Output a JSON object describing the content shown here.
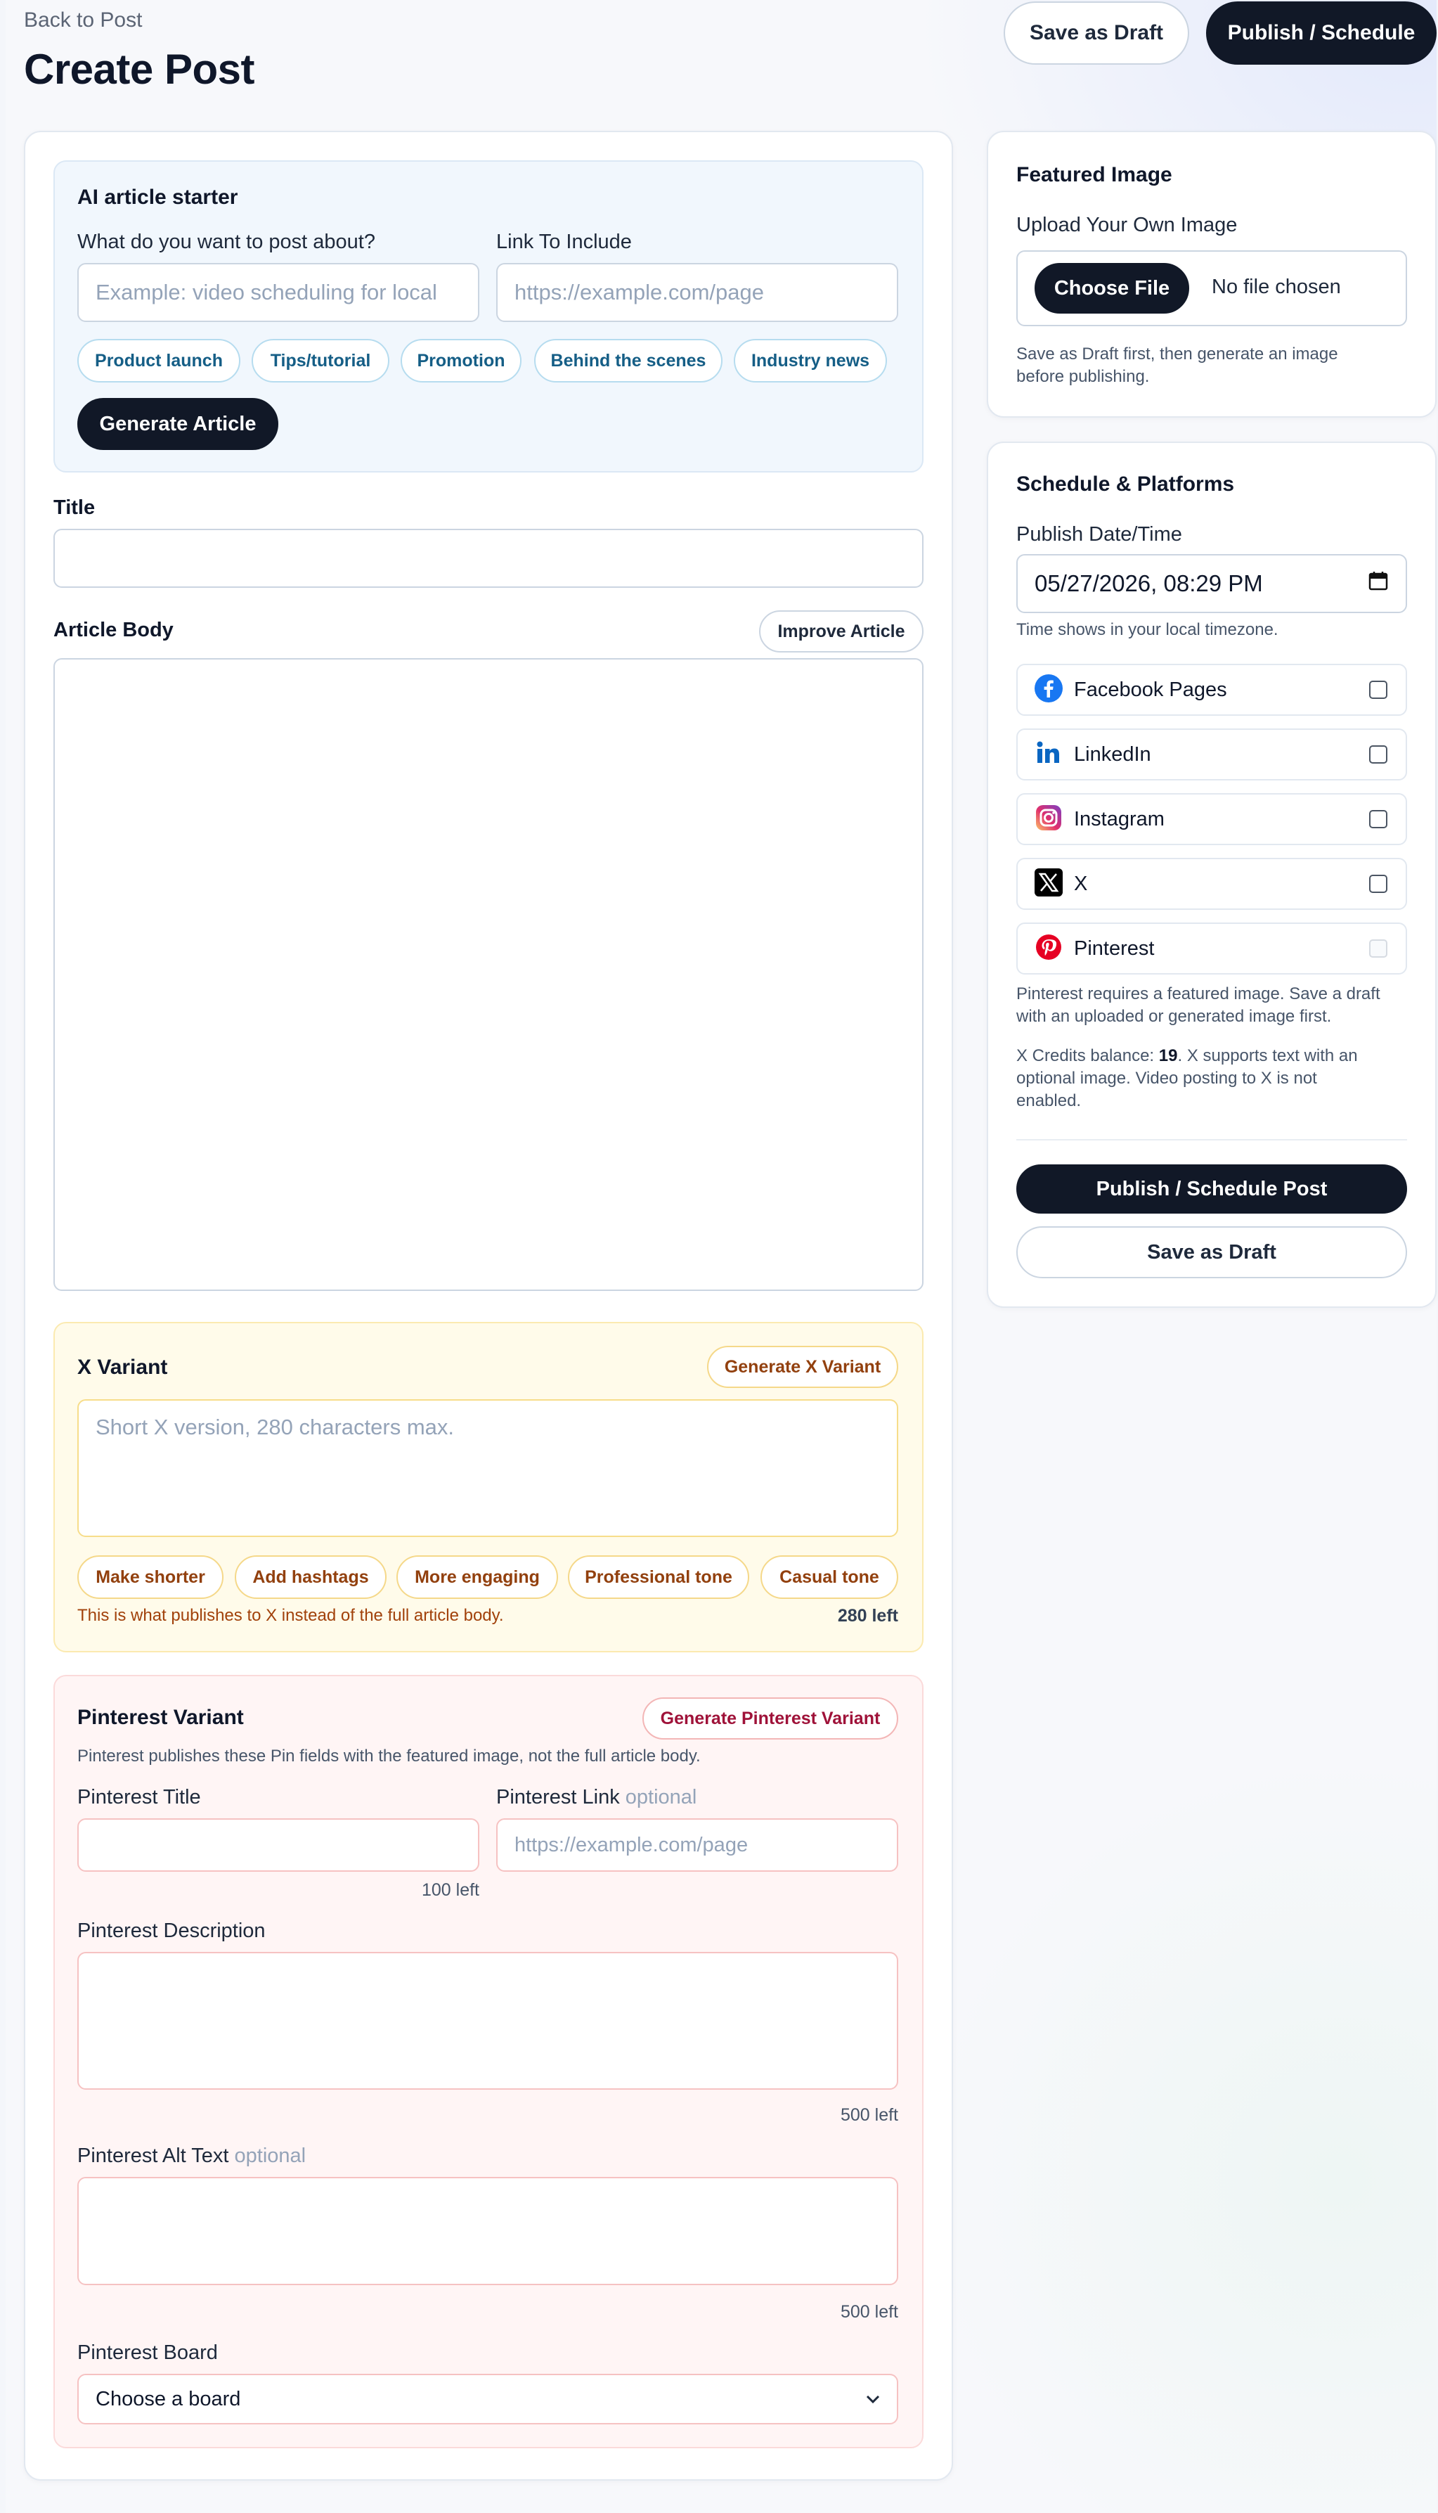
{
  "header": {
    "back_link": "Back to Post",
    "title": "Create Post",
    "save_draft": "Save as Draft",
    "publish": "Publish / Schedule"
  },
  "ai_starter": {
    "title": "AI article starter",
    "topic_label": "What do you want to post about?",
    "topic_placeholder": "Example: video scheduling for local",
    "link_label": "Link To Include",
    "link_placeholder": "https://example.com/page",
    "chips": [
      "Product launch",
      "Tips/tutorial",
      "Promotion",
      "Behind the scenes",
      "Industry news"
    ],
    "generate_button": "Generate Article"
  },
  "title_field": {
    "label": "Title",
    "value": ""
  },
  "article": {
    "label": "Article Body",
    "improve_button": "Improve Article",
    "value": ""
  },
  "x_variant": {
    "title": "X Variant",
    "generate_button": "Generate X Variant",
    "placeholder": "Short X version, 280 characters max.",
    "chips": [
      "Make shorter",
      "Add hashtags",
      "More engaging",
      "Professional tone",
      "Casual tone"
    ],
    "hint": "This is what publishes to X instead of the full article body.",
    "counter": "280 left"
  },
  "pinterest_variant": {
    "title": "Pinterest Variant",
    "generate_button": "Generate Pinterest Variant",
    "description": "Pinterest publishes these Pin fields with the featured image, not the full article body.",
    "pin_title_label": "Pinterest Title",
    "pin_title_counter": "100 left",
    "pin_link_label": "Pinterest Link",
    "optional": "optional",
    "pin_link_placeholder": "https://example.com/page",
    "pin_desc_label": "Pinterest Description",
    "pin_desc_counter": "500 left",
    "alt_label": "Pinterest Alt Text",
    "alt_counter": "500 left",
    "board_label": "Pinterest Board",
    "board_selected": "Choose a board"
  },
  "featured_image": {
    "title": "Featured Image",
    "upload_label": "Upload Your Own Image",
    "choose_button": "Choose File",
    "file_status": "No file chosen",
    "note_line1": "Save as Draft first, then generate an image",
    "note_line2": "before publishing."
  },
  "schedule": {
    "title": "Schedule & Platforms",
    "date_label": "Publish Date/Time",
    "date_value": "05/27/2026, 08:29 PM",
    "timezone_note": "Time shows in your local timezone.",
    "platforms": [
      {
        "name": "Facebook Pages",
        "icon": "facebook-icon",
        "checked": false,
        "disabled": false
      },
      {
        "name": "LinkedIn",
        "icon": "linkedin-icon",
        "checked": false,
        "disabled": false
      },
      {
        "name": "Instagram",
        "icon": "instagram-icon",
        "checked": false,
        "disabled": false
      },
      {
        "name": "X",
        "icon": "x-icon",
        "checked": false,
        "disabled": false
      },
      {
        "name": "Pinterest",
        "icon": "pinterest-icon",
        "checked": false,
        "disabled": true
      }
    ],
    "pinterest_note_line1": "Pinterest requires a featured image. Save a draft",
    "pinterest_note_line2": "with an uploaded or generated image first.",
    "x_credits_prefix": "X Credits balance: ",
    "x_credits_value": "19",
    "x_credits_suffix": ". X supports text with an",
    "x_note_line2": "optional image. Video posting to X is not",
    "x_note_line3": "enabled.",
    "publish_button": "Publish / Schedule Post",
    "draft_button": "Save as Draft"
  },
  "colors": {
    "dark": "#111827",
    "facebook": "#1877f2",
    "linkedin": "#0a66c2",
    "pinterest": "#e60023",
    "x_accent": "#92400e",
    "pinterest_accent": "#9f1239"
  }
}
